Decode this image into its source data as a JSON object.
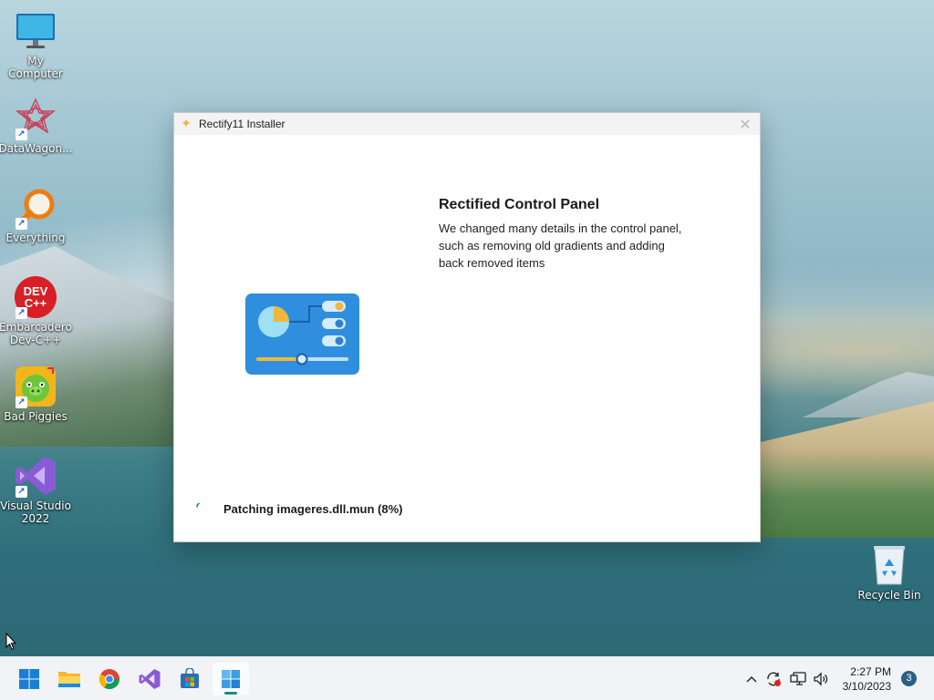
{
  "desktop": {
    "icons": [
      {
        "label": "My Computer"
      },
      {
        "label": "DataWagon..."
      },
      {
        "label": "Everything"
      },
      {
        "label": "Embarcadero Dev-C++"
      },
      {
        "label": "Bad Piggies"
      },
      {
        "label": "Visual Studio 2022"
      },
      {
        "label": "Recycle Bin"
      }
    ],
    "devcpp_logo_text": "DEV C++"
  },
  "window": {
    "title": "Rectify11 Installer",
    "close_glyph": "✕",
    "heading": "Rectified Control Panel",
    "description": "We changed many details in the control panel, such as removing old gradients and adding back removed items",
    "status": "Patching imageres.dll.mun (8%)",
    "progress_percent": 8
  },
  "taskbar": {
    "apps": [
      "start",
      "file-explorer",
      "chrome",
      "visual-studio",
      "microsoft-store",
      "rectify11-installer"
    ],
    "active_app": "rectify11-installer",
    "tray_icons": [
      "chevron-up-icon",
      "sync-icon",
      "network-icon",
      "volume-icon"
    ],
    "time": "2:27 PM",
    "date": "3/10/2023",
    "notification_count": "3"
  },
  "colors": {
    "accent": "#1c8a83",
    "panel_icon_blue": "#2f8fde",
    "panel_icon_yellow": "#f1b63c"
  }
}
